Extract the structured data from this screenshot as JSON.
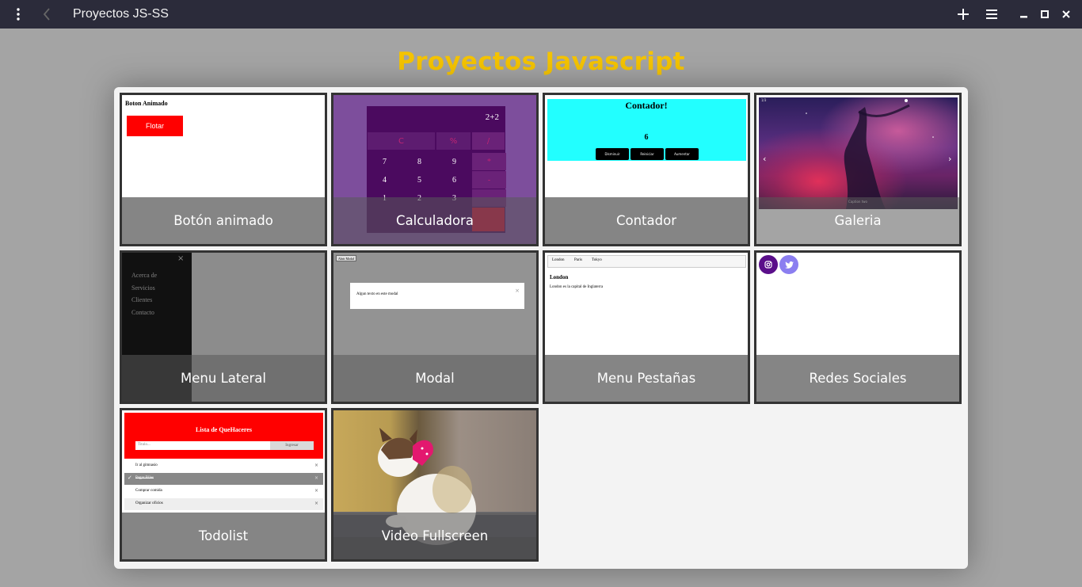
{
  "window": {
    "title": "Proyectos JS-SS"
  },
  "page": {
    "title": "Proyectos Javascript",
    "title_color": "#f5c400"
  },
  "cards": [
    {
      "label": "Botón animado"
    },
    {
      "label": "Calculadora"
    },
    {
      "label": "Contador"
    },
    {
      "label": "Galeria"
    },
    {
      "label": "Menu Lateral"
    },
    {
      "label": "Modal"
    },
    {
      "label": "Menu Pestañas"
    },
    {
      "label": "Redes Sociales"
    },
    {
      "label": "Todolist"
    },
    {
      "label": "Video Fullscreen"
    }
  ],
  "previews": {
    "boton": {
      "heading": "Boton Animado",
      "button": "Flotar"
    },
    "calc": {
      "display": "2+2",
      "ops": [
        "C",
        "%",
        "/"
      ],
      "rows": [
        [
          "7",
          "8",
          "9",
          "*"
        ],
        [
          "4",
          "5",
          "6",
          "-"
        ],
        [
          "1",
          "2",
          "3",
          ""
        ]
      ]
    },
    "contador": {
      "heading": "Contador!",
      "value": "6",
      "buttons": [
        "Disminuir",
        "Reiniciar",
        "Aumentar"
      ]
    },
    "galeria": {
      "counter": "1/3",
      "caption": "Caption two"
    },
    "menu": {
      "items": [
        "Acerca de",
        "Servicios",
        "Clientes",
        "Contacto"
      ],
      "close": "×"
    },
    "modal": {
      "open_button": "Abrir Modal",
      "text": "Algun texto en este modal",
      "close": "×"
    },
    "tabs": {
      "tabs": [
        "London",
        "Paris",
        "Tokyo"
      ],
      "heading": "London",
      "text": "London es la capital de Inglaterra"
    },
    "todo": {
      "heading": "Lista de QueHaceres",
      "placeholder": "Titulo...",
      "add": "Ingresar",
      "items": [
        "Ir al gimnasio",
        "Pagar Biles",
        "Comprar comida",
        "Organizar oficios"
      ]
    }
  },
  "colors": {
    "titlebar": "#2b2b3a",
    "label_bg": "#787878",
    "accent_red": "#ff0000",
    "cyan": "#22ffff"
  }
}
